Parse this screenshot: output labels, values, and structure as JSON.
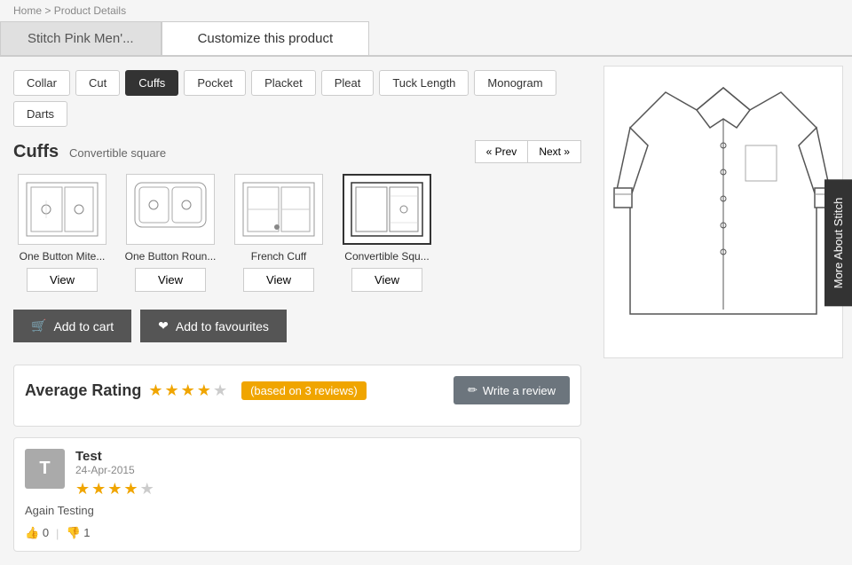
{
  "breadcrumb": [
    "Home",
    "Product Details"
  ],
  "tabs": {
    "stitch": "Stitch Pink Men'...",
    "customize": "Customize this product"
  },
  "options": [
    {
      "label": "Collar",
      "active": false
    },
    {
      "label": "Cut",
      "active": false
    },
    {
      "label": "Cuffs",
      "active": true
    },
    {
      "label": "Pocket",
      "active": false
    },
    {
      "label": "Placket",
      "active": false
    },
    {
      "label": "Pleat",
      "active": false
    },
    {
      "label": "Tuck Length",
      "active": false
    },
    {
      "label": "Monogram",
      "active": false
    },
    {
      "label": "Darts",
      "active": false
    }
  ],
  "section": {
    "title": "Cuffs",
    "subtitle": "Convertible square",
    "prev_label": "« Prev",
    "next_label": "Next »"
  },
  "cuffs": [
    {
      "name": "One Button Mite...",
      "selected": false,
      "view": "View"
    },
    {
      "name": "One Button Roun...",
      "selected": false,
      "view": "View"
    },
    {
      "name": "French Cuff",
      "selected": false,
      "view": "View"
    },
    {
      "name": "Convertible Squ...",
      "selected": true,
      "view": "View"
    }
  ],
  "actions": {
    "cart_label": "Add to cart",
    "fav_label": "Add to favourites"
  },
  "rating": {
    "title": "Average Rating",
    "stars": 3.5,
    "review_count": "based on 3 reviews",
    "write_review": "Write a review"
  },
  "review": {
    "author_initial": "T",
    "author_name": "Test",
    "date": "24-Apr-2015",
    "text": "Again Testing",
    "stars": 3.5,
    "likes": "0",
    "dislikes": "1"
  },
  "side_tab": "More About Stitch"
}
